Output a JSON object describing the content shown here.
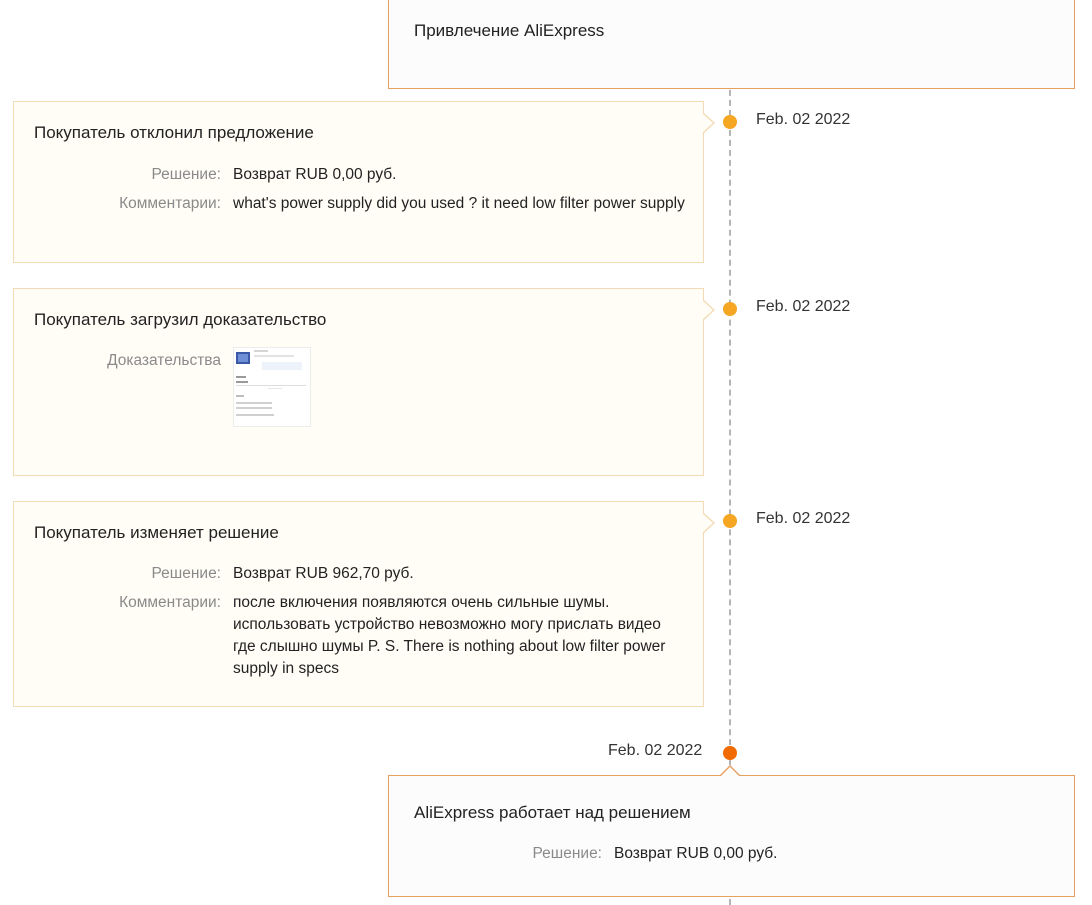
{
  "header_card": {
    "title": "Привлечение AliExpress"
  },
  "events": [
    {
      "title": "Покупатель отклонил предложение",
      "date": "Feb. 02 2022",
      "decision_label": "Решение:",
      "decision_value": "Возврат RUB 0,00 руб.",
      "comment_label": "Комментарии:",
      "comment_value": "what's power supply did you used ? it need low filter power supply"
    },
    {
      "title": "Покупатель загрузил доказательство",
      "date": "Feb. 02 2022",
      "evidence_label": "Доказательства"
    },
    {
      "title": "Покупатель изменяет решение",
      "date": "Feb. 02 2022",
      "decision_label": "Решение:",
      "decision_value": "Возврат RUB 962,70 руб.",
      "comment_label": "Комментарии:",
      "comment_value": "после включения появляются очень сильные шумы. использовать устройство невозможно могу прислать видео где слышно шумы P. S. There is nothing about low filter power supply in specs"
    },
    {
      "title": "AliExpress работает над решением",
      "date": "Feb. 02 2022",
      "decision_label": "Решение:",
      "decision_value": "Возврат RUB 0,00 руб."
    }
  ],
  "colors": {
    "dot": "#f5a623",
    "dot_active": "#f26b00",
    "card_border_left": "#f3dcb5",
    "card_border_right": "#e8a061",
    "timeline": "#b5b5b5"
  },
  "icons": {
    "evidence": "evidence-image-thumbnail"
  }
}
